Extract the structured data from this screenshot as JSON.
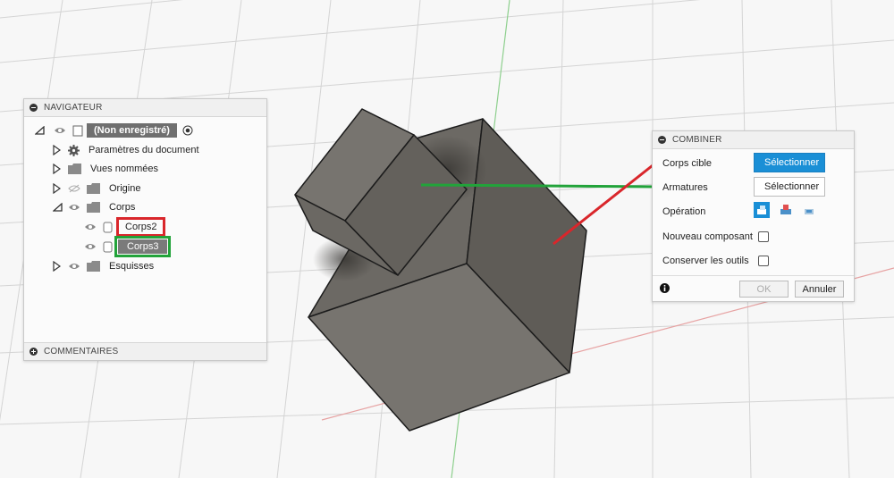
{
  "navigator": {
    "title": "NAVIGATEUR",
    "root_label": "(Non enregistré)",
    "items": [
      {
        "label": "Paramètres du document"
      },
      {
        "label": "Vues nommées"
      },
      {
        "label": "Origine"
      },
      {
        "label": "Corps"
      },
      {
        "label": "Corps2"
      },
      {
        "label": "Corps3"
      },
      {
        "label": "Esquisses"
      }
    ],
    "comments_label": "COMMENTAIRES"
  },
  "combine": {
    "title": "COMBINER",
    "target_label": "Corps cible",
    "target_button": "Sélectionner",
    "tools_label": "Armatures",
    "tools_button": "Sélectionner",
    "operation_label": "Opération",
    "new_component_label": "Nouveau composant",
    "keep_tools_label": "Conserver les outils",
    "ok_label": "OK",
    "cancel_label": "Annuler"
  },
  "colors": {
    "highlight_red": "#d9262b",
    "highlight_green": "#22a33a",
    "select_active": "#1a8fd6",
    "body_face": "#6e6b66"
  }
}
